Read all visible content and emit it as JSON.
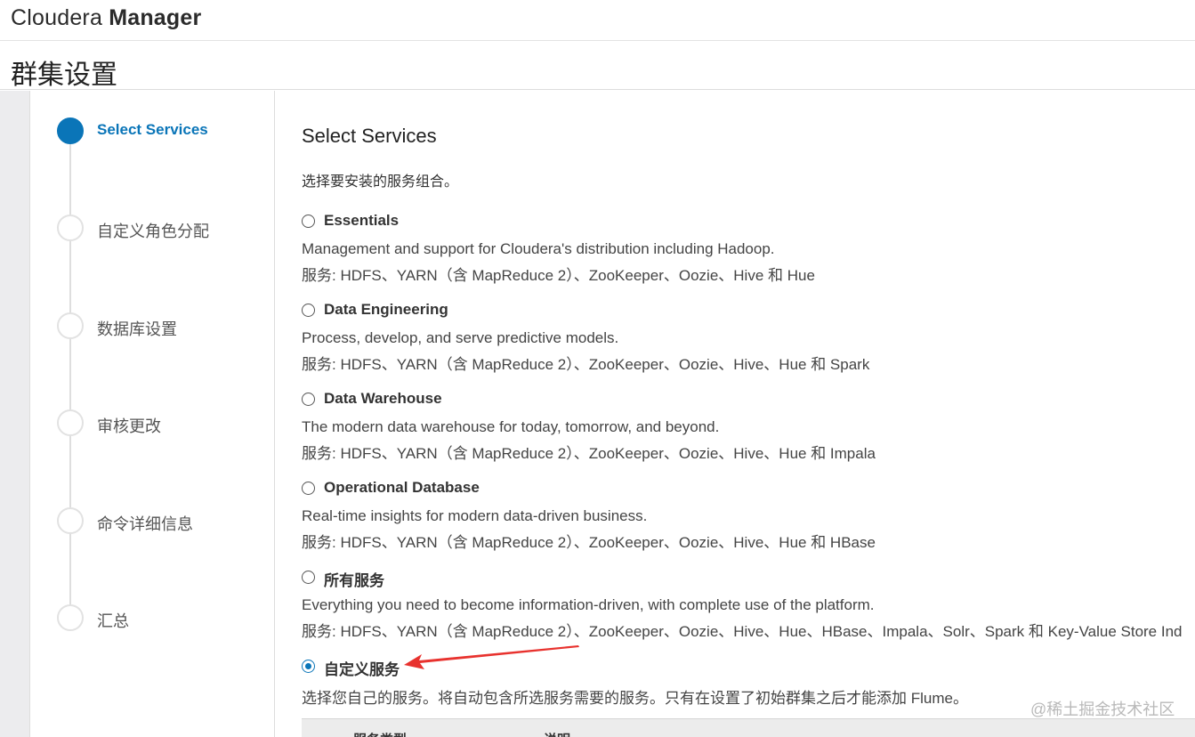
{
  "app": {
    "brand_light": "Cloudera ",
    "brand_bold": "Manager"
  },
  "page": {
    "title": "群集设置"
  },
  "wizard": {
    "steps": [
      {
        "label": "Select Services",
        "active": true
      },
      {
        "label": "自定义角色分配",
        "active": false
      },
      {
        "label": "数据库设置",
        "active": false
      },
      {
        "label": "审核更改",
        "active": false
      },
      {
        "label": "命令详细信息",
        "active": false
      },
      {
        "label": "汇总",
        "active": false
      }
    ]
  },
  "main": {
    "heading": "Select Services",
    "intro": "选择要安装的服务组合。",
    "options": [
      {
        "name": "Essentials",
        "description": "Management and support for Cloudera's distribution including Hadoop.",
        "services": "服务: HDFS、YARN（含 MapReduce 2）、ZooKeeper、Oozie、Hive 和 Hue",
        "selected": false
      },
      {
        "name": "Data Engineering",
        "description": "Process, develop, and serve predictive models.",
        "services": "服务: HDFS、YARN（含 MapReduce 2）、ZooKeeper、Oozie、Hive、Hue 和 Spark",
        "selected": false
      },
      {
        "name": "Data Warehouse",
        "description": "The modern data warehouse for today, tomorrow, and beyond.",
        "services": "服务: HDFS、YARN（含 MapReduce 2）、ZooKeeper、Oozie、Hive、Hue 和 Impala",
        "selected": false
      },
      {
        "name": "Operational Database",
        "description": "Real-time insights for modern data-driven business.",
        "services": "服务: HDFS、YARN（含 MapReduce 2）、ZooKeeper、Oozie、Hive、Hue 和 HBase",
        "selected": false
      },
      {
        "name": "所有服务",
        "description": "Everything you need to become information-driven, with complete use of the platform.",
        "services": "服务: HDFS、YARN（含 MapReduce 2）、ZooKeeper、Oozie、Hive、Hue、HBase、Impala、Solr、Spark 和 Key-Value Store Ind",
        "selected": false
      },
      {
        "name": "自定义服务",
        "description": "选择您自己的服务。将自动包含所选服务需要的服务。只有在设置了初始群集之后才能添加 Flume。",
        "services": "",
        "selected": true
      }
    ],
    "table_headers": [
      "服务类型",
      "说明"
    ]
  },
  "colors": {
    "accent": "#0a75b8",
    "arrow": "#e8322e"
  },
  "watermark": "@稀土掘金技术社区"
}
